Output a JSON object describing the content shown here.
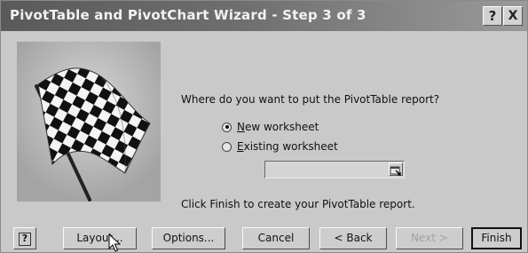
{
  "window": {
    "title": "PivotTable and PivotChart Wizard - Step 3 of 3",
    "help_glyph": "?",
    "close_glyph": "X"
  },
  "content": {
    "question": "Where do you want to put the PivotTable report?",
    "options": [
      {
        "label_hotkey": "N",
        "label_rest": "ew worksheet",
        "selected": true
      },
      {
        "label_hotkey": "E",
        "label_rest": "xisting worksheet",
        "selected": false
      }
    ],
    "reference_value": "",
    "finish_note": "Click Finish to create your PivotTable report."
  },
  "buttons": {
    "help": "?",
    "layout": "Layout...",
    "options": "Options...",
    "cancel": "Cancel",
    "back": "< Back",
    "next": "Next >",
    "finish": "Finish"
  },
  "icons": {
    "art": "checkered-flag-icon",
    "reference_button": "collapse-dialog-icon",
    "cursor": "mouse-pointer-icon"
  },
  "colors": {
    "titlebar_start": "#5a5a5a",
    "titlebar_end": "#9a9a9a",
    "dialog_face": "#c9c9c9"
  }
}
